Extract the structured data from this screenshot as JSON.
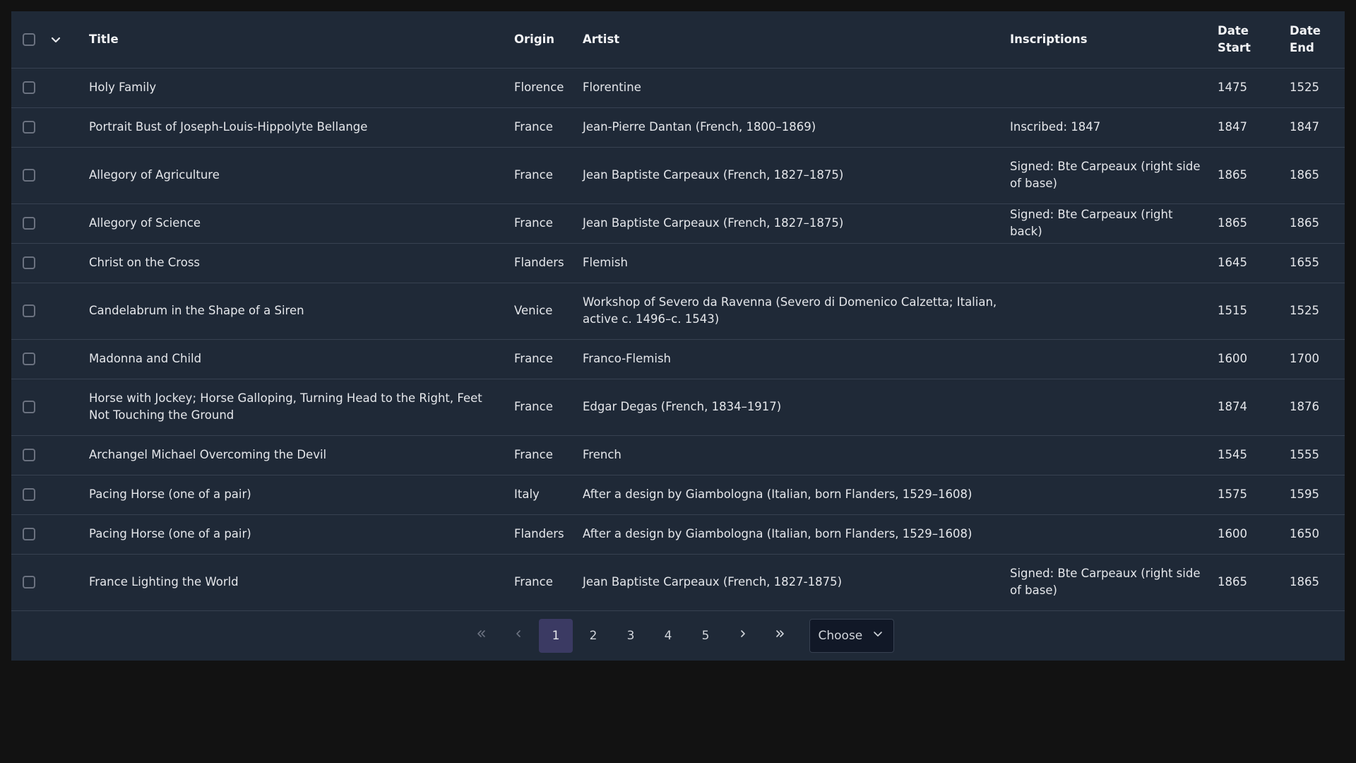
{
  "columns": {
    "title": "Title",
    "origin": "Origin",
    "artist": "Artist",
    "inscriptions": "Inscriptions",
    "date_start": "Date Start",
    "date_end": "Date End"
  },
  "rows": [
    {
      "title": "Holy Family",
      "origin": "Florence",
      "artist": "Florentine",
      "inscriptions": "",
      "date_start": "1475",
      "date_end": "1525"
    },
    {
      "title": "Portrait Bust of Joseph-Louis-Hippolyte Bellange",
      "origin": "France",
      "artist": "Jean-Pierre Dantan (French, 1800–1869)",
      "inscriptions": "Inscribed: 1847",
      "date_start": "1847",
      "date_end": "1847"
    },
    {
      "title": "Allegory of Agriculture",
      "origin": "France",
      "artist": "Jean Baptiste Carpeaux (French, 1827–1875)",
      "inscriptions": "Signed: Bte Carpeaux (right side of base)",
      "date_start": "1865",
      "date_end": "1865"
    },
    {
      "title": "Allegory of Science",
      "origin": "France",
      "artist": "Jean Baptiste Carpeaux (French, 1827–1875)",
      "inscriptions": "Signed: Bte Carpeaux (right back)",
      "date_start": "1865",
      "date_end": "1865"
    },
    {
      "title": "Christ on the Cross",
      "origin": "Flanders",
      "artist": "Flemish",
      "inscriptions": "",
      "date_start": "1645",
      "date_end": "1655"
    },
    {
      "title": "Candelabrum in the Shape of a Siren",
      "origin": "Venice",
      "artist": "Workshop of Severo da Ravenna (Severo di Domenico Calzetta; Italian, active c. 1496–c. 1543)",
      "inscriptions": "",
      "date_start": "1515",
      "date_end": "1525"
    },
    {
      "title": "Madonna and Child",
      "origin": "France",
      "artist": "Franco-Flemish",
      "inscriptions": "",
      "date_start": "1600",
      "date_end": "1700"
    },
    {
      "title": "Horse with Jockey; Horse Galloping, Turning Head to the Right, Feet Not Touching the Ground",
      "origin": "France",
      "artist": "Edgar Degas (French, 1834–1917)",
      "inscriptions": "",
      "date_start": "1874",
      "date_end": "1876"
    },
    {
      "title": "Archangel Michael Overcoming the Devil",
      "origin": "France",
      "artist": "French",
      "inscriptions": "",
      "date_start": "1545",
      "date_end": "1555"
    },
    {
      "title": "Pacing Horse (one of a pair)",
      "origin": "Italy",
      "artist": "After a design by Giambologna (Italian, born Flanders, 1529–1608)",
      "inscriptions": "",
      "date_start": "1575",
      "date_end": "1595"
    },
    {
      "title": "Pacing Horse (one of a pair)",
      "origin": "Flanders",
      "artist": "After a design by Giambologna (Italian, born Flanders, 1529–1608)",
      "inscriptions": "",
      "date_start": "1600",
      "date_end": "1650"
    },
    {
      "title": "France Lighting the World",
      "origin": "France",
      "artist": "Jean Baptiste Carpeaux (French, 1827-1875)",
      "inscriptions": "Signed: Bte Carpeaux (right side of base)",
      "date_start": "1865",
      "date_end": "1865"
    }
  ],
  "pagination": {
    "pages": [
      "1",
      "2",
      "3",
      "4",
      "5"
    ],
    "current_page": "1",
    "first_icon": "double-chevron-left-icon",
    "prev_icon": "chevron-left-icon",
    "next_icon": "chevron-right-icon",
    "last_icon": "double-chevron-right-icon",
    "page_size_placeholder": "Choose"
  },
  "colors": {
    "page_background": "#121212",
    "table_background": "#1f2937",
    "active_page": "#3b3a63",
    "row_border": "#374151"
  }
}
